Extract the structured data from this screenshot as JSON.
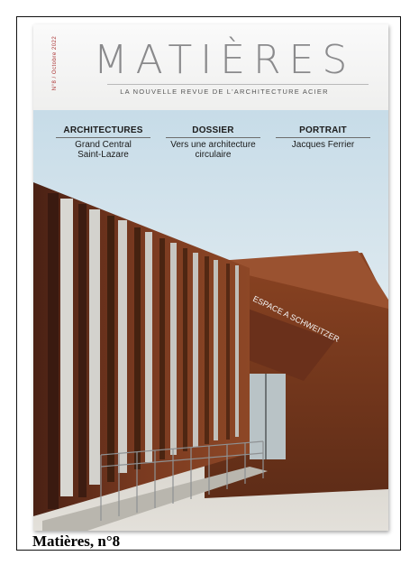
{
  "magazine": {
    "title": "MATIÈRES",
    "subtitle": "LA NOUVELLE REVUE DE L'ARCHITECTURE ACIER",
    "side_text": "N°8 / Octobre 2022"
  },
  "rubrics": [
    {
      "heading": "ARCHITECTURES",
      "line1": "Grand Central",
      "line2": "Saint-Lazare"
    },
    {
      "heading": "DOSSIER",
      "line1": "Vers une architecture",
      "line2": "circulaire"
    },
    {
      "heading": "PORTRAIT",
      "line1": "Jacques Ferrier",
      "line2": ""
    }
  ],
  "building_sign": "ESPACE A SCHWEITZER",
  "caption": "Matières, n°8",
  "colors": {
    "sky": "#cfe1ea",
    "corten": "#7a3b22",
    "ground": "#d9d6cf"
  }
}
